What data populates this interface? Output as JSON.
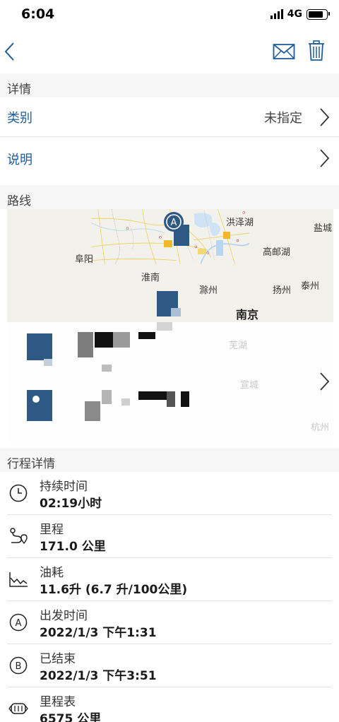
{
  "status_bar": {
    "time": "6:04",
    "network": "4G"
  },
  "nav": {
    "icons": [
      "back-chevron-icon",
      "mail-icon",
      "trash-icon"
    ]
  },
  "sections": {
    "details": "详情",
    "route": "路线",
    "trip_details": "行程详情"
  },
  "details": {
    "category_label": "类别",
    "category_value": "未指定",
    "description_label": "说明"
  },
  "map": {
    "labels": [
      "洪泽湖",
      "盐城",
      "阜阳",
      "高邮湖",
      "淮南",
      "滁州",
      "扬州",
      "泰州",
      "南京",
      "芜湖",
      "宣城",
      "杭州"
    ],
    "marker_start": "A"
  },
  "trip": [
    {
      "icon": "clock-icon",
      "title": "持续时间",
      "value": "02:19小时"
    },
    {
      "icon": "route-icon",
      "title": "里程",
      "value": "171.0 公里"
    },
    {
      "icon": "fuel-chart-icon",
      "title": "油耗",
      "value": "11.6升 (6.7 升/100公里)"
    },
    {
      "icon": "start-a-icon",
      "title": "出发时间",
      "value": "2022/1/3 下午1:31"
    },
    {
      "icon": "end-b-icon",
      "title": "已结束",
      "value": "2022/1/3 下午3:51"
    },
    {
      "icon": "odometer-icon",
      "title": "里程表",
      "value": "6575 公里"
    }
  ]
}
